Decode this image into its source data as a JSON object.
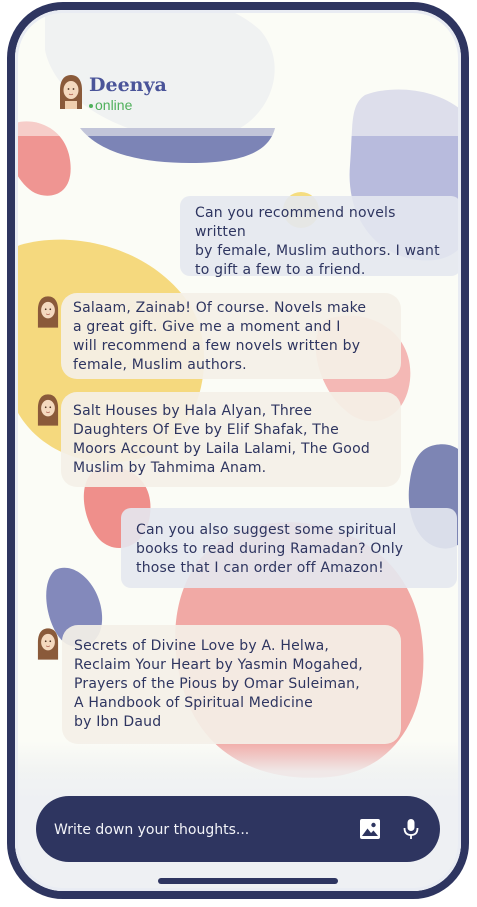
{
  "app": {
    "name": "Deenya",
    "status": "online"
  },
  "messages": [
    {
      "sender": "user",
      "text": "Can you recommend novels written\nby female, Muslim authors. I want\nto gift a few to a friend."
    },
    {
      "sender": "bot",
      "text": "Salaam, Zainab! Of course. Novels make\na great gift. Give me a moment and I\nwill recommend a few novels written by\nfemale, Muslim authors."
    },
    {
      "sender": "bot",
      "text": "Salt Houses by Hala Alyan, Three\nDaughters Of Eve by Elif Shafak, The\nMoors Account by Laila Lalami, The Good\nMuslim by Tahmima Anam."
    },
    {
      "sender": "user",
      "text": "Can you also suggest some spiritual\nbooks to read during Ramadan? Only\nthose that I can order off Amazon!"
    },
    {
      "sender": "bot",
      "text": "Secrets of Divine Love by A. Helwa,\nReclaim Your Heart by Yasmin Mogahed,\nPrayers of the Pious by Omar Suleiman,\nA Handbook of Spiritual Medicine\nby Ibn Daud"
    }
  ],
  "composer": {
    "placeholder": "Write down your thoughts..."
  },
  "icons": {
    "image": "image-icon",
    "mic": "microphone-icon",
    "avatar": "bot-avatar"
  },
  "colors": {
    "navy": "#2e3560",
    "brand": "#4a5499",
    "online": "#4fb05b",
    "coral": "#ef8d8a",
    "yellow": "#f5d87a",
    "lavender": "#a9aed6"
  }
}
